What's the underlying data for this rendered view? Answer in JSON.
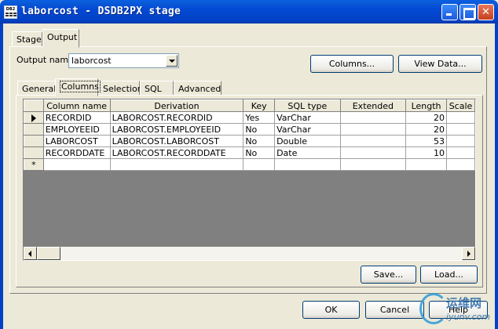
{
  "window": {
    "title": "laborcost - DSDB2PX stage",
    "icon_label": "DB2"
  },
  "outer_tabs": [
    {
      "label": "Stage"
    },
    {
      "label": "Output"
    }
  ],
  "output_name": {
    "label": "Output name:",
    "value": "laborcost"
  },
  "top_buttons": {
    "columns": "Columns...",
    "view_data": "View Data..."
  },
  "inner_tabs": [
    {
      "label": "General"
    },
    {
      "label": "Columns"
    },
    {
      "label": "Selection"
    },
    {
      "label": "SQL"
    },
    {
      "label": "Advanced"
    }
  ],
  "grid": {
    "headers": [
      "Column name",
      "Derivation",
      "Key",
      "SQL type",
      "Extended",
      "Length",
      "Scale"
    ],
    "rows": [
      {
        "name": "RECORDID",
        "derivation": "LABORCOST.RECORDID",
        "key": "Yes",
        "sql_type": "VarChar",
        "extended": "",
        "length": "20",
        "scale": ""
      },
      {
        "name": "EMPLOYEEID",
        "derivation": "LABORCOST.EMPLOYEEID",
        "key": "No",
        "sql_type": "VarChar",
        "extended": "",
        "length": "20",
        "scale": ""
      },
      {
        "name": "LABORCOST",
        "derivation": "LABORCOST.LABORCOST",
        "key": "No",
        "sql_type": "Double",
        "extended": "",
        "length": "53",
        "scale": ""
      },
      {
        "name": "RECORDDATE",
        "derivation": "LABORCOST.RECORDDATE",
        "key": "No",
        "sql_type": "Date",
        "extended": "",
        "length": "10",
        "scale": ""
      }
    ],
    "new_row_marker": "*"
  },
  "grid_buttons": {
    "save": "Save...",
    "load": "Load..."
  },
  "footer_buttons": {
    "ok": "OK",
    "cancel": "Cancel",
    "help": "Help"
  },
  "watermark": {
    "line1": "运维网",
    "line2": "iyunv.com"
  }
}
